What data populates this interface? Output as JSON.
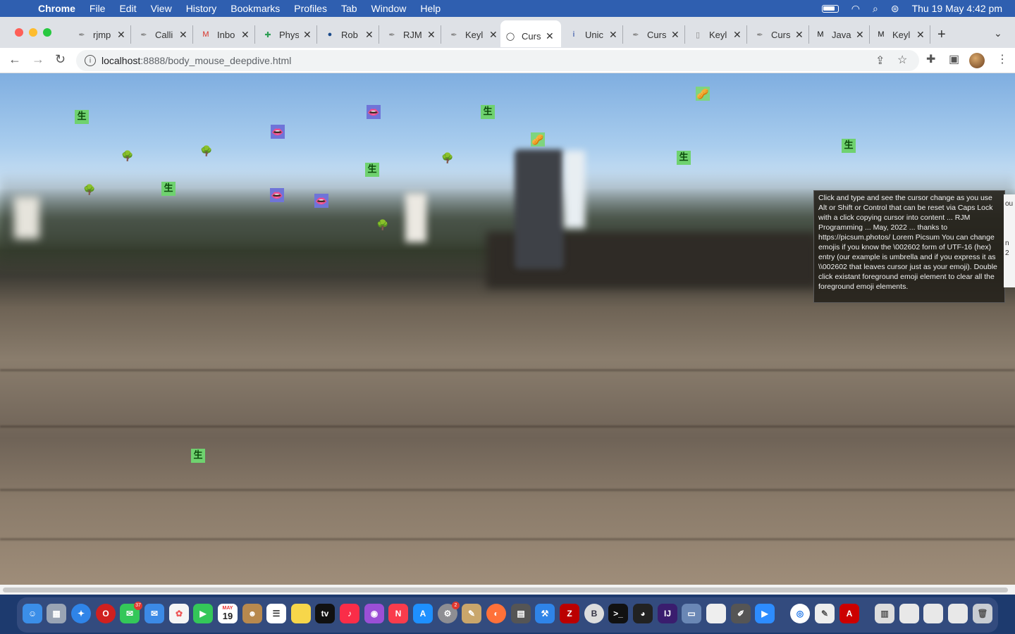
{
  "menubar": {
    "app": "Chrome",
    "items": [
      "File",
      "Edit",
      "View",
      "History",
      "Bookmarks",
      "Profiles",
      "Tab",
      "Window",
      "Help"
    ],
    "datetime": "Thu 19 May  4:42 pm"
  },
  "tabs": [
    {
      "label": "rjmp",
      "icon": "rjm-quill-icon",
      "color": "#888888"
    },
    {
      "label": "Calli",
      "icon": "rjm-quill-icon",
      "color": "#888888"
    },
    {
      "label": "Inbo",
      "icon": "gmail-icon",
      "color": "#d93025"
    },
    {
      "label": "Phys",
      "icon": "plus-icon",
      "color": "#2e9e55"
    },
    {
      "label": "Rob",
      "icon": "globe-icon",
      "color": "#1a4a8a"
    },
    {
      "label": "RJM",
      "icon": "rjm-quill-icon",
      "color": "#888888"
    },
    {
      "label": "Keyl",
      "icon": "rjm-quill-icon",
      "color": "#888888"
    },
    {
      "label": "Curs",
      "icon": "github-icon",
      "color": "#333333",
      "active": true
    },
    {
      "label": "Unic",
      "icon": "info-icon",
      "color": "#1a3e9e"
    },
    {
      "label": "Curs",
      "icon": "rjm-quill-icon",
      "color": "#888888"
    },
    {
      "label": "Keyl",
      "icon": "page-icon",
      "color": "#888888"
    },
    {
      "label": "Curs",
      "icon": "rjm-quill-icon",
      "color": "#888888"
    },
    {
      "label": "Java",
      "icon": "mdn-icon",
      "color": "#111111"
    },
    {
      "label": "Keyl",
      "icon": "mdn-icon",
      "color": "#111111"
    }
  ],
  "address": {
    "host": "localhost",
    "rest": ":8888/body_mouse_deepdive.html"
  },
  "note": {
    "text": "Click and type and see the cursor change as you use Alt or Shift or Control that can be reset via Caps Lock with a click copying cursor into content ... RJM Programming ... May, 2022 ... thanks to https://picsum.photos/ Lorem Picsum You can change emojis if you know the \\002602 form of UTF-16 (hex) entry (our example is umbrella and if you express it as \\\\002602 that leaves cursor just as your emoji).  Double click existant foreground emoji element to clear all the foreground emoji elements."
  },
  "edge_panel": {
    "line1": "ou",
    "line2": "n",
    "line3": "2"
  },
  "emojis": {
    "tree": "🌳",
    "green_char": "生",
    "lips": "👄",
    "nut": "🥜"
  },
  "dock": {
    "calendar_month": "MAY",
    "calendar_day": "19",
    "tv_label": "tv",
    "messages_badge": "37",
    "settings_badge": "2"
  }
}
